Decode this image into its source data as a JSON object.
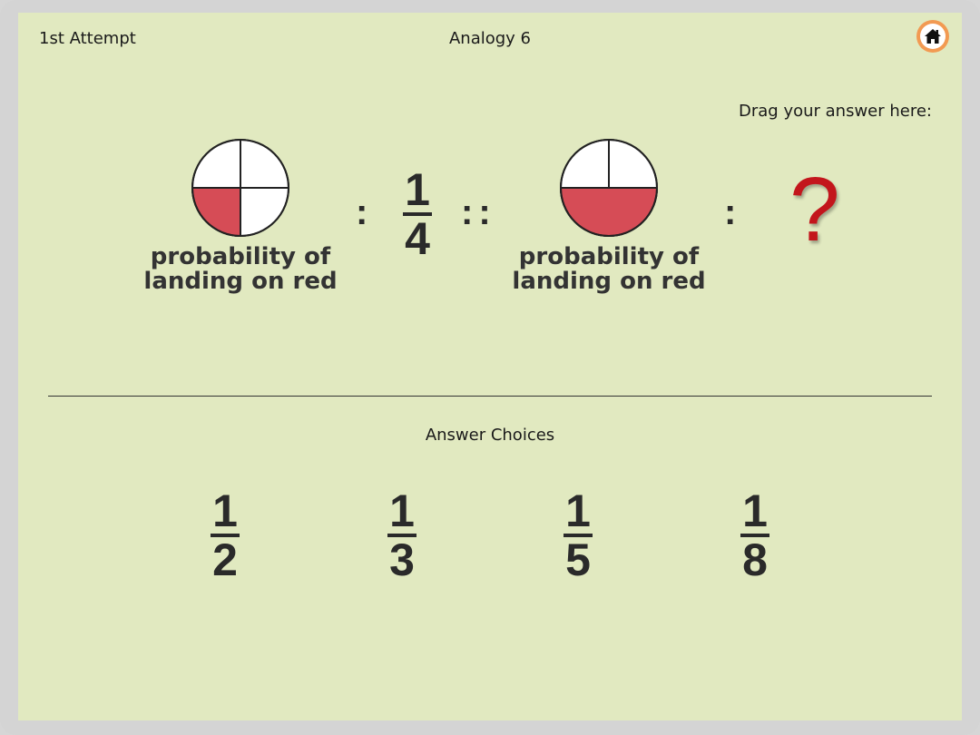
{
  "header": {
    "attempt": "1st Attempt",
    "title": "Analogy 6",
    "home_icon": "home-icon"
  },
  "drag_label": "Drag your answer here:",
  "analogy": {
    "first_caption_line1": "probability of",
    "first_caption_line2": "landing on red",
    "first_pie": {
      "parts": 4,
      "red_parts": 1
    },
    "colon1": ":",
    "answer1": {
      "numerator": "1",
      "denominator": "4"
    },
    "double_colon": "::",
    "second_caption_line1": "probability of",
    "second_caption_line2": "landing on red",
    "second_pie": {
      "parts": 4,
      "red_parts": 2
    },
    "colon2": ":",
    "unknown": "?"
  },
  "choices_label": "Answer Choices",
  "choices": [
    {
      "numerator": "1",
      "denominator": "2"
    },
    {
      "numerator": "1",
      "denominator": "3"
    },
    {
      "numerator": "1",
      "denominator": "5"
    },
    {
      "numerator": "1",
      "denominator": "8"
    }
  ],
  "colors": {
    "background": "#e1e9c0",
    "red_section": "#d64c56",
    "question_mark": "#c3161c",
    "home_ring": "#f29a52"
  }
}
